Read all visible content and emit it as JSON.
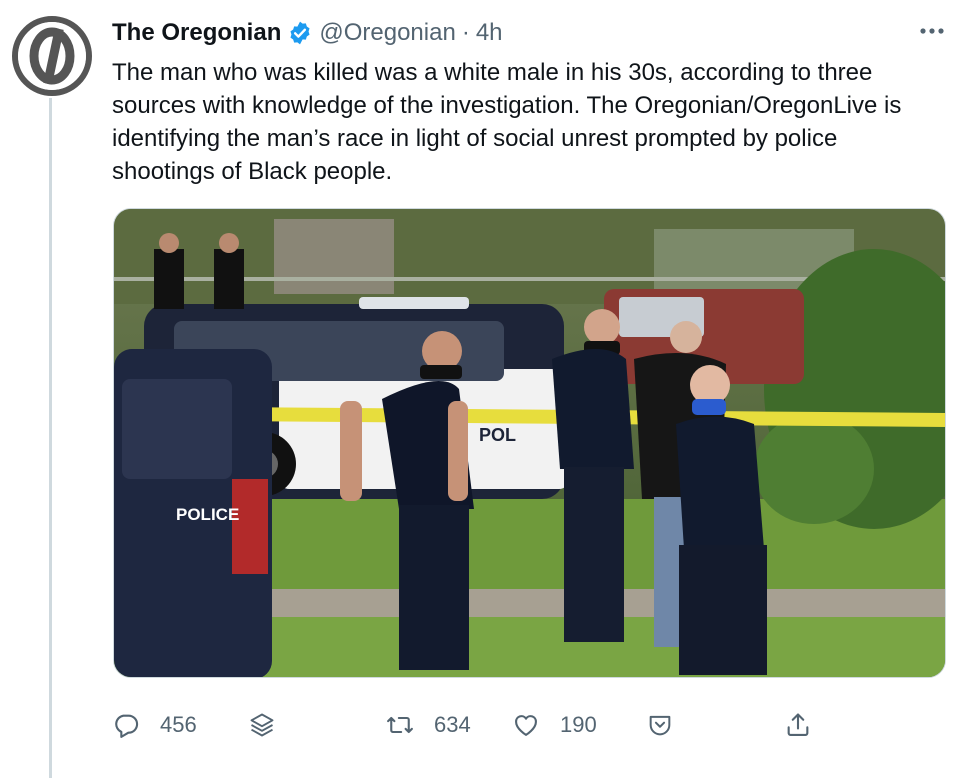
{
  "tweet": {
    "author": {
      "name": "The Oregonian",
      "handle": "@Oregonian",
      "verified": true,
      "avatar_icon": "oregonian-logo"
    },
    "separator": "·",
    "time": "4h",
    "text": "The man who was killed was a white male in his 30s, according to three sources with knowledge of the investigation. The Oregonian/OregonLive is identifying the man’s race in light of social unrest prompted by police shootings of Black people.",
    "media": {
      "vehicle_label": "POLICE",
      "car_label_fragment": "POL"
    },
    "actions": {
      "reply_count": "456",
      "retweet_count": "634",
      "like_count": "190"
    }
  },
  "icons": [
    "more-icon",
    "verified-icon",
    "reply-icon",
    "stack-icon",
    "retweet-icon",
    "like-icon",
    "tip-icon",
    "share-icon"
  ],
  "colors": {
    "text": "#0f1419",
    "muted": "#536471",
    "verified_blue": "#1d9bf0",
    "thread_line": "#cfd9de"
  }
}
